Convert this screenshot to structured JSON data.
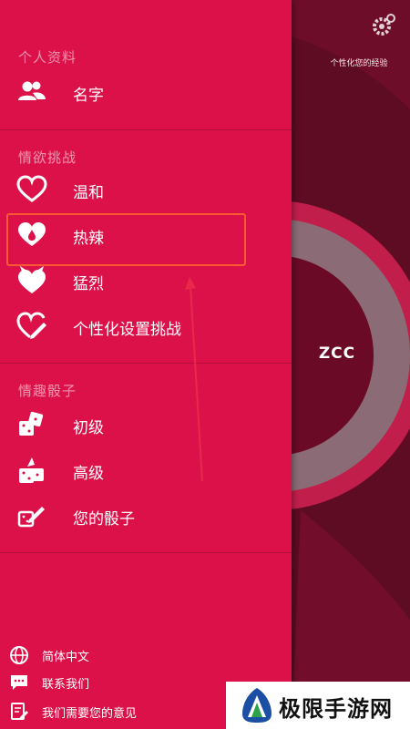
{
  "app": {
    "personalize_text": "个性化您的经验",
    "avatar_name": "ZCC"
  },
  "profile": {
    "title": "个人资料",
    "items": [
      {
        "label": "名字",
        "icon": "people-icon"
      }
    ]
  },
  "challenges": {
    "title": "情欲挑战",
    "items": [
      {
        "label": "温和",
        "icon": "heart-outline-icon"
      },
      {
        "label": "热辣",
        "icon": "heart-drop-icon"
      },
      {
        "label": "猛烈",
        "icon": "heart-devil-icon"
      },
      {
        "label": "个性化设置挑战",
        "icon": "heart-pencil-icon"
      }
    ]
  },
  "dice": {
    "title": "情趣骰子",
    "items": [
      {
        "label": "初级",
        "icon": "dice-icon"
      },
      {
        "label": "高级",
        "icon": "dice-arrow-icon"
      },
      {
        "label": "您的骰子",
        "icon": "dice-pencil-icon"
      }
    ]
  },
  "footer": {
    "items": [
      {
        "label": "简体中文",
        "icon": "globe-icon"
      },
      {
        "label": "联系我们",
        "icon": "chat-icon"
      },
      {
        "label": "我们需要您的意见",
        "icon": "feedback-icon"
      }
    ]
  },
  "watermark": {
    "text": "极限手游网"
  },
  "colors": {
    "drawer": "#dc1149",
    "background": "#5a0a22",
    "highlight": "#ff5a32"
  }
}
